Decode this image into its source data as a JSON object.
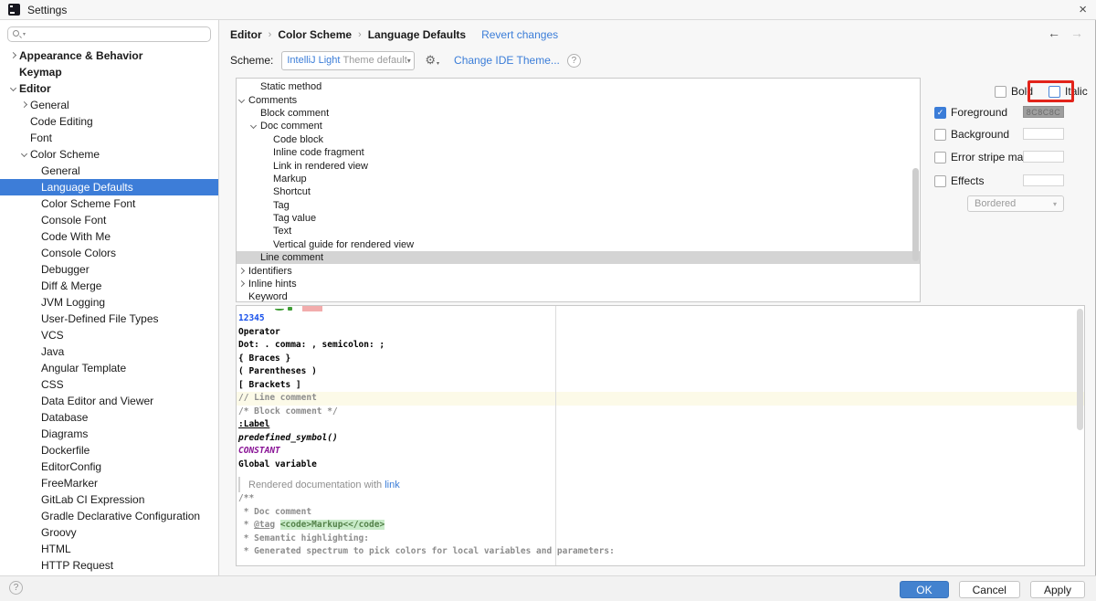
{
  "colors": {
    "accent_link": "#3B7DD8",
    "sidebar_selection": "#3D7DD8",
    "annotation_red": "#E2231A",
    "swatch_bg": "#9E9E9E",
    "line_highlight": "#FCFAE8",
    "doc_code_bg": "#C8EBC8",
    "number_blue": "#1750EB",
    "constant_purple": "#871094",
    "comment_gray": "#8C8C8C",
    "ok_button": "#4382CF"
  },
  "window": {
    "title": "Settings",
    "close_glyph": "×"
  },
  "nav": {
    "back_glyph": "←",
    "forward_glyph": "→"
  },
  "header": {
    "breadcrumb": [
      "Editor",
      "Color Scheme",
      "Language Defaults"
    ],
    "separator": "›",
    "revert_link": "Revert changes"
  },
  "scheme": {
    "label": "Scheme:",
    "value_name": "IntelliJ Light",
    "value_suffix": "Theme default",
    "dropdown_glyph": "▾",
    "gear_caret_glyph": "▾",
    "change_theme_link": "Change IDE Theme...",
    "help_glyph": "?"
  },
  "sidebar": {
    "items": [
      {
        "label": "Appearance & Behavior",
        "indent": 9,
        "cls": "bold col"
      },
      {
        "label": "Keymap",
        "indent": 9,
        "cls": "bold"
      },
      {
        "label": "Editor",
        "indent": 9,
        "cls": "bold exp"
      },
      {
        "label": "General",
        "indent": 21,
        "cls": "col"
      },
      {
        "label": "Code Editing",
        "indent": 21,
        "cls": ""
      },
      {
        "label": "Font",
        "indent": 21,
        "cls": ""
      },
      {
        "label": "Color Scheme",
        "indent": 21,
        "cls": "exp"
      },
      {
        "label": "General",
        "indent": 33,
        "cls": ""
      },
      {
        "label": "Language Defaults",
        "indent": 33,
        "cls": "sel"
      },
      {
        "label": "Color Scheme Font",
        "indent": 33,
        "cls": ""
      },
      {
        "label": "Console Font",
        "indent": 33,
        "cls": ""
      },
      {
        "label": "Code With Me",
        "indent": 33,
        "cls": ""
      },
      {
        "label": "Console Colors",
        "indent": 33,
        "cls": ""
      },
      {
        "label": "Debugger",
        "indent": 33,
        "cls": ""
      },
      {
        "label": "Diff & Merge",
        "indent": 33,
        "cls": ""
      },
      {
        "label": "JVM Logging",
        "indent": 33,
        "cls": ""
      },
      {
        "label": "User-Defined File Types",
        "indent": 33,
        "cls": ""
      },
      {
        "label": "VCS",
        "indent": 33,
        "cls": ""
      },
      {
        "label": "Java",
        "indent": 33,
        "cls": ""
      },
      {
        "label": "Angular Template",
        "indent": 33,
        "cls": ""
      },
      {
        "label": "CSS",
        "indent": 33,
        "cls": ""
      },
      {
        "label": "Data Editor and Viewer",
        "indent": 33,
        "cls": ""
      },
      {
        "label": "Database",
        "indent": 33,
        "cls": ""
      },
      {
        "label": "Diagrams",
        "indent": 33,
        "cls": ""
      },
      {
        "label": "Dockerfile",
        "indent": 33,
        "cls": ""
      },
      {
        "label": "EditorConfig",
        "indent": 33,
        "cls": ""
      },
      {
        "label": "FreeMarker",
        "indent": 33,
        "cls": ""
      },
      {
        "label": "GitLab CI Expression",
        "indent": 33,
        "cls": ""
      },
      {
        "label": "Gradle Declarative Configuration",
        "indent": 33,
        "cls": ""
      },
      {
        "label": "Groovy",
        "indent": 33,
        "cls": ""
      },
      {
        "label": "HTML",
        "indent": 33,
        "cls": ""
      },
      {
        "label": "HTTP Request",
        "indent": 33,
        "cls": ""
      }
    ]
  },
  "attributes": {
    "items": [
      {
        "label": "Static method",
        "indent": 13,
        "cls": ""
      },
      {
        "label": "Comments",
        "indent": 0,
        "cls": "exp"
      },
      {
        "label": "Block comment",
        "indent": 13,
        "cls": ""
      },
      {
        "label": "Doc comment",
        "indent": 13,
        "cls": "exp"
      },
      {
        "label": "Code block",
        "indent": 27,
        "cls": ""
      },
      {
        "label": "Inline code fragment",
        "indent": 27,
        "cls": ""
      },
      {
        "label": "Link in rendered view",
        "indent": 27,
        "cls": ""
      },
      {
        "label": "Markup",
        "indent": 27,
        "cls": ""
      },
      {
        "label": "Shortcut",
        "indent": 27,
        "cls": ""
      },
      {
        "label": "Tag",
        "indent": 27,
        "cls": ""
      },
      {
        "label": "Tag value",
        "indent": 27,
        "cls": ""
      },
      {
        "label": "Text",
        "indent": 27,
        "cls": ""
      },
      {
        "label": "Vertical guide for rendered view",
        "indent": 27,
        "cls": ""
      },
      {
        "label": "Line comment",
        "indent": 13,
        "cls": "sel"
      },
      {
        "label": "Identifiers",
        "indent": 0,
        "cls": "col"
      },
      {
        "label": "Inline hints",
        "indent": 0,
        "cls": "col"
      },
      {
        "label": "Keyword",
        "indent": 0,
        "cls": ""
      }
    ]
  },
  "props": {
    "bold_label": "Bold",
    "italic_label": "Italic",
    "foreground_label": "Foreground",
    "foreground_value": "8C8C8C",
    "background_label": "Background",
    "error_stripe_label": "Error stripe mark",
    "effects_label": "Effects",
    "effect_type": "Bordered",
    "dropdown_glyph": "▾",
    "check_glyph": "✓"
  },
  "preview": {
    "number": "12345",
    "operator": "Operator",
    "punctuation": "Dot: . comma: , semicolon: ;",
    "braces": "{ Braces }",
    "parentheses": "( Parentheses )",
    "brackets": "[ Brackets ]",
    "line_comment": "// Line comment",
    "block_comment": "/* Block comment */",
    "label_line": ":Label",
    "predefined": "predefined_symbol()",
    "constant": "CONSTANT",
    "global_variable": "Global variable",
    "rendered_prefix": "Rendered documentation with ",
    "rendered_link": "link",
    "doc_open": "/**",
    "doc_comment": " * Doc comment",
    "doc_tag_prefix": " * ",
    "doc_tag": "@tag",
    "doc_tag_space": " ",
    "doc_code": "<code>Markup<</code>",
    "doc_semantic": " * Semantic highlighting:",
    "doc_generated": " * Generated spectrum to pick colors for local variables and parameters:"
  },
  "footer": {
    "help_glyph": "?",
    "ok_label": "OK",
    "cancel_label": "Cancel",
    "apply_label": "Apply"
  }
}
